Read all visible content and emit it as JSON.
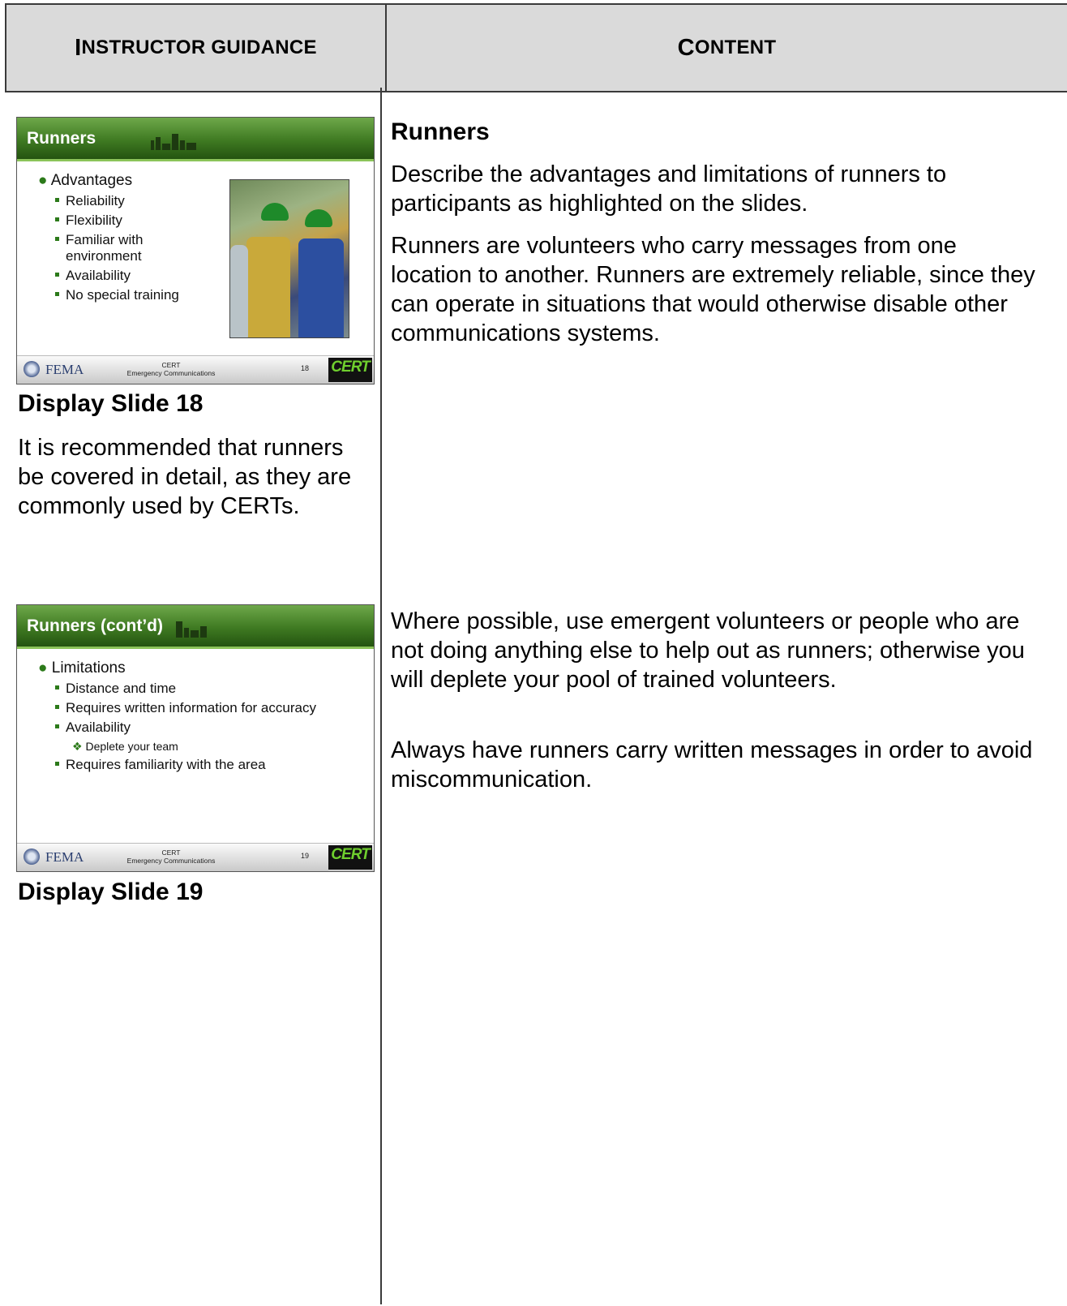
{
  "table": {
    "header": {
      "left": {
        "first": "I",
        "rest": "NSTRUCTOR GUIDANCE"
      },
      "right": {
        "first": "C",
        "rest": "ONTENT"
      }
    }
  },
  "slides": [
    {
      "title": "Runners",
      "bullets": {
        "l1": "Advantages",
        "items": [
          "Reliability",
          "Flexibility",
          "Familiar with",
          "environment",
          "Availability",
          "No special training"
        ]
      },
      "footer": {
        "agency": "FEMA",
        "line1": "CERT",
        "line2": "Emergency Communications",
        "number": "18",
        "logo": "CERT"
      },
      "caption": "Display Slide 18",
      "note": "It is recommended that runners be covered in detail, as they are commonly used by CERTs."
    },
    {
      "title": "Runners (cont’d)",
      "bullets": {
        "l1": "Limitations",
        "items": [
          "Distance and time",
          "Requires written information for accuracy",
          "Availability",
          "Deplete your team",
          "Requires familiarity with the area"
        ]
      },
      "footer": {
        "agency": "FEMA",
        "line1": "CERT",
        "line2": "Emergency Communications",
        "number": "19",
        "logo": "CERT"
      },
      "caption": "Display Slide 19"
    }
  ],
  "content": {
    "heading": "Runners",
    "paragraphs": [
      "Describe the advantages and limitations of runners to participants as highlighted on the slides.",
      "Runners are volunteers who carry messages from one location to another.  Runners are extremely reliable, since they can operate in situations that would otherwise disable other communications systems.",
      "Where possible, use emergent volunteers or people who are not doing anything else to help out as runners; otherwise you will deplete your pool of trained volunteers.",
      "Always have runners carry written messages in order to avoid miscommunication."
    ]
  },
  "colors": {
    "header_bg": "#dadada",
    "slide_green": "#3f7a22",
    "cert_green": "#6fcf2e",
    "fema_blue": "#2b3f70"
  }
}
